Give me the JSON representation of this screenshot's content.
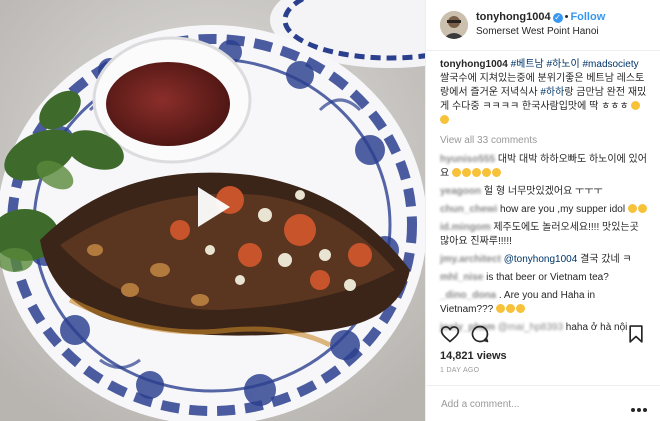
{
  "post": {
    "username": "tonyhong1004",
    "verified_icon": "verified-badge-icon",
    "separator": "•",
    "follow_label": "Follow",
    "location": "Somerset West Point Hanoi",
    "video_icon": "play-icon"
  },
  "caption": {
    "username": "tonyhong1004",
    "tag1": "#베트남",
    "tag2": "#하노이",
    "tag3": "#madsociety",
    "text1": "쌀국수에 지쳐있는중에 분위기좋은 베트남 레스토랑에서 즐거운 저녁식사",
    "tag4": "#하하",
    "text2": "랑 금만남 완전 재밌게 수다중 ㅋㅋㅋㅋ 한국사람입맛에 딱 ㅎㅎㅎ"
  },
  "view_all": "View all 33 comments",
  "comments": [
    {
      "username": "hyuniso555",
      "text": "대박 대박 하하오빠도 하노이에 있어요"
    },
    {
      "username": "yeagoon",
      "text": "헐 형 너무맛있겠어요 ㅜㅜㅜ"
    },
    {
      "username": "chun_chewi",
      "text": "how are you ,my supper idol"
    },
    {
      "username": "id.mingom",
      "text": "제주도에도 놀러오세요!!!! 맛있는곳 많아요 진짜루!!!!!"
    },
    {
      "username": "jmy.architect",
      "mention": "@tonyhong1004",
      "text": "결국 갔네 ㅋ"
    },
    {
      "username": "mhl_nise",
      "text": "is that beer or Vietnam tea?"
    },
    {
      "username": "_dino_dona",
      "text": ". Are you and Haha in Vietnam???"
    },
    {
      "username": "joely_pham",
      "mention": "@mai_hp8393",
      "text": "haha ở hà nội"
    }
  ],
  "actions": {
    "like_icon": "heart-icon",
    "comment_icon": "comment-icon",
    "save_icon": "bookmark-icon"
  },
  "views": "14,821 views",
  "time_ago": "1 DAY AGO",
  "add_comment_placeholder": "Add a comment...",
  "more_icon": "more-options-icon",
  "colors": {
    "link_blue": "#3897f0",
    "hashtag": "#003569",
    "muted": "#999999",
    "border": "#efefef",
    "plate_blue": "#2b3f8f"
  }
}
